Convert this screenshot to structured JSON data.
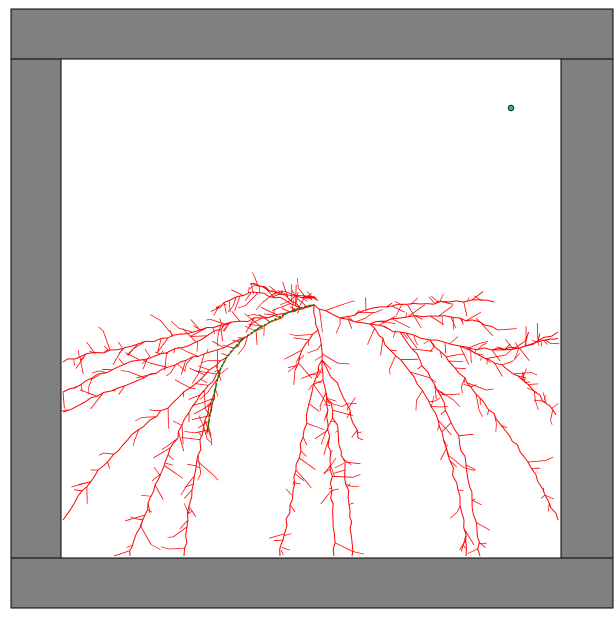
{
  "scene": {
    "type": "rrt-path-planning-visualization",
    "background_color": "#ffffff",
    "wall_fill": "#808080",
    "wall_stroke": "#000000",
    "tree_color": "#ff0000",
    "path_color": "#008000",
    "goal_fill": "#22c55e",
    "goal_stroke": "#000000",
    "obstacles": [
      "top-wall",
      "bottom-wall",
      "left-wall",
      "right-wall"
    ],
    "markers": [
      "goal-marker"
    ]
  }
}
